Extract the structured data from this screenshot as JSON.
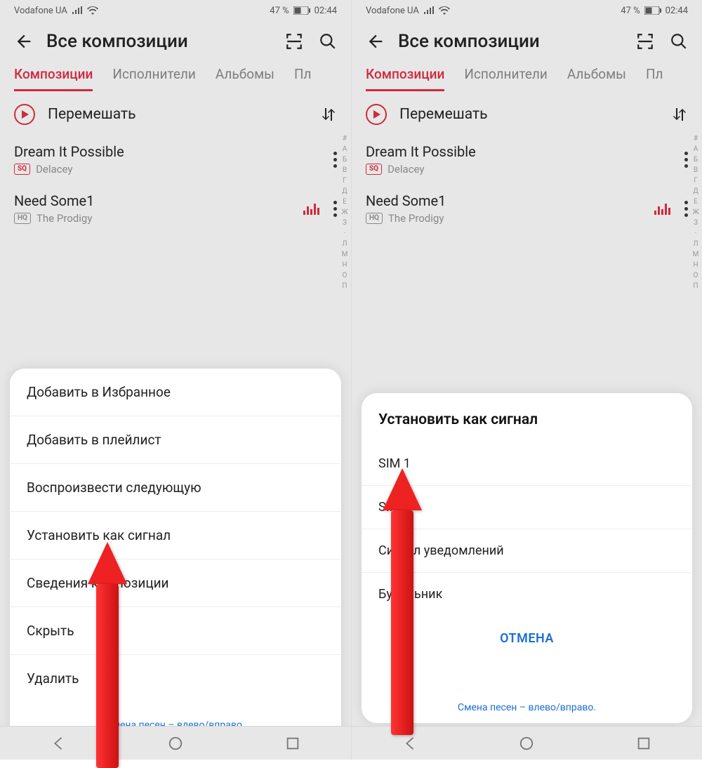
{
  "status": {
    "carrier": "Vodafone UA",
    "battery_percent": "47 %",
    "time": "02:44"
  },
  "header": {
    "title": "Все композиции"
  },
  "tabs": {
    "compositions": "Композиции",
    "artists": "Исполнители",
    "albums": "Альбомы",
    "playlists_partial": "Пл"
  },
  "shuffle": {
    "label": "Перемешать"
  },
  "songs": [
    {
      "title": "Dream It Possible",
      "artist": "Delacey",
      "quality": "SQ",
      "playing": false
    },
    {
      "title": "Need Some1",
      "artist": "The Prodigy",
      "quality": "HQ",
      "playing": true
    }
  ],
  "alpha_index": [
    "#",
    "А",
    "Б",
    "В",
    "Г",
    "Д",
    "Е",
    "Ж",
    "З",
    "·",
    "Л",
    "М",
    "Н",
    "О",
    "П"
  ],
  "menu_left": {
    "items": [
      "Добавить в Избранное",
      "Добавить в плейлист",
      "Воспроизвести следующую",
      "Установить как сигнал",
      "Сведения композиции",
      "Скрыть",
      "Удалить"
    ]
  },
  "menu_right": {
    "title": "Установить как сигнал",
    "options": [
      "SIM 1",
      "SIM 2",
      "Сигнал уведомлений",
      "Будильник"
    ],
    "cancel": "ОТМЕНА"
  },
  "playback_hint": "Смена песен – влево/вправо."
}
